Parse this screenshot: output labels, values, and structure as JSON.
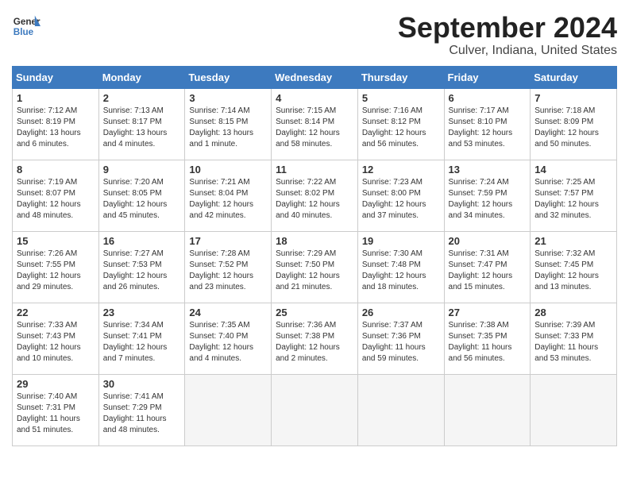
{
  "header": {
    "logo_line1": "General",
    "logo_line2": "Blue",
    "month": "September 2024",
    "location": "Culver, Indiana, United States"
  },
  "weekdays": [
    "Sunday",
    "Monday",
    "Tuesday",
    "Wednesday",
    "Thursday",
    "Friday",
    "Saturday"
  ],
  "weeks": [
    [
      {
        "day": "1",
        "sunrise": "7:12 AM",
        "sunset": "8:19 PM",
        "daylight": "13 hours and 6 minutes."
      },
      {
        "day": "2",
        "sunrise": "7:13 AM",
        "sunset": "8:17 PM",
        "daylight": "13 hours and 4 minutes."
      },
      {
        "day": "3",
        "sunrise": "7:14 AM",
        "sunset": "8:15 PM",
        "daylight": "13 hours and 1 minute."
      },
      {
        "day": "4",
        "sunrise": "7:15 AM",
        "sunset": "8:14 PM",
        "daylight": "12 hours and 58 minutes."
      },
      {
        "day": "5",
        "sunrise": "7:16 AM",
        "sunset": "8:12 PM",
        "daylight": "12 hours and 56 minutes."
      },
      {
        "day": "6",
        "sunrise": "7:17 AM",
        "sunset": "8:10 PM",
        "daylight": "12 hours and 53 minutes."
      },
      {
        "day": "7",
        "sunrise": "7:18 AM",
        "sunset": "8:09 PM",
        "daylight": "12 hours and 50 minutes."
      }
    ],
    [
      {
        "day": "8",
        "sunrise": "7:19 AM",
        "sunset": "8:07 PM",
        "daylight": "12 hours and 48 minutes."
      },
      {
        "day": "9",
        "sunrise": "7:20 AM",
        "sunset": "8:05 PM",
        "daylight": "12 hours and 45 minutes."
      },
      {
        "day": "10",
        "sunrise": "7:21 AM",
        "sunset": "8:04 PM",
        "daylight": "12 hours and 42 minutes."
      },
      {
        "day": "11",
        "sunrise": "7:22 AM",
        "sunset": "8:02 PM",
        "daylight": "12 hours and 40 minutes."
      },
      {
        "day": "12",
        "sunrise": "7:23 AM",
        "sunset": "8:00 PM",
        "daylight": "12 hours and 37 minutes."
      },
      {
        "day": "13",
        "sunrise": "7:24 AM",
        "sunset": "7:59 PM",
        "daylight": "12 hours and 34 minutes."
      },
      {
        "day": "14",
        "sunrise": "7:25 AM",
        "sunset": "7:57 PM",
        "daylight": "12 hours and 32 minutes."
      }
    ],
    [
      {
        "day": "15",
        "sunrise": "7:26 AM",
        "sunset": "7:55 PM",
        "daylight": "12 hours and 29 minutes."
      },
      {
        "day": "16",
        "sunrise": "7:27 AM",
        "sunset": "7:53 PM",
        "daylight": "12 hours and 26 minutes."
      },
      {
        "day": "17",
        "sunrise": "7:28 AM",
        "sunset": "7:52 PM",
        "daylight": "12 hours and 23 minutes."
      },
      {
        "day": "18",
        "sunrise": "7:29 AM",
        "sunset": "7:50 PM",
        "daylight": "12 hours and 21 minutes."
      },
      {
        "day": "19",
        "sunrise": "7:30 AM",
        "sunset": "7:48 PM",
        "daylight": "12 hours and 18 minutes."
      },
      {
        "day": "20",
        "sunrise": "7:31 AM",
        "sunset": "7:47 PM",
        "daylight": "12 hours and 15 minutes."
      },
      {
        "day": "21",
        "sunrise": "7:32 AM",
        "sunset": "7:45 PM",
        "daylight": "12 hours and 13 minutes."
      }
    ],
    [
      {
        "day": "22",
        "sunrise": "7:33 AM",
        "sunset": "7:43 PM",
        "daylight": "12 hours and 10 minutes."
      },
      {
        "day": "23",
        "sunrise": "7:34 AM",
        "sunset": "7:41 PM",
        "daylight": "12 hours and 7 minutes."
      },
      {
        "day": "24",
        "sunrise": "7:35 AM",
        "sunset": "7:40 PM",
        "daylight": "12 hours and 4 minutes."
      },
      {
        "day": "25",
        "sunrise": "7:36 AM",
        "sunset": "7:38 PM",
        "daylight": "12 hours and 2 minutes."
      },
      {
        "day": "26",
        "sunrise": "7:37 AM",
        "sunset": "7:36 PM",
        "daylight": "11 hours and 59 minutes."
      },
      {
        "day": "27",
        "sunrise": "7:38 AM",
        "sunset": "7:35 PM",
        "daylight": "11 hours and 56 minutes."
      },
      {
        "day": "28",
        "sunrise": "7:39 AM",
        "sunset": "7:33 PM",
        "daylight": "11 hours and 53 minutes."
      }
    ],
    [
      {
        "day": "29",
        "sunrise": "7:40 AM",
        "sunset": "7:31 PM",
        "daylight": "11 hours and 51 minutes."
      },
      {
        "day": "30",
        "sunrise": "7:41 AM",
        "sunset": "7:29 PM",
        "daylight": "11 hours and 48 minutes."
      },
      null,
      null,
      null,
      null,
      null
    ]
  ]
}
